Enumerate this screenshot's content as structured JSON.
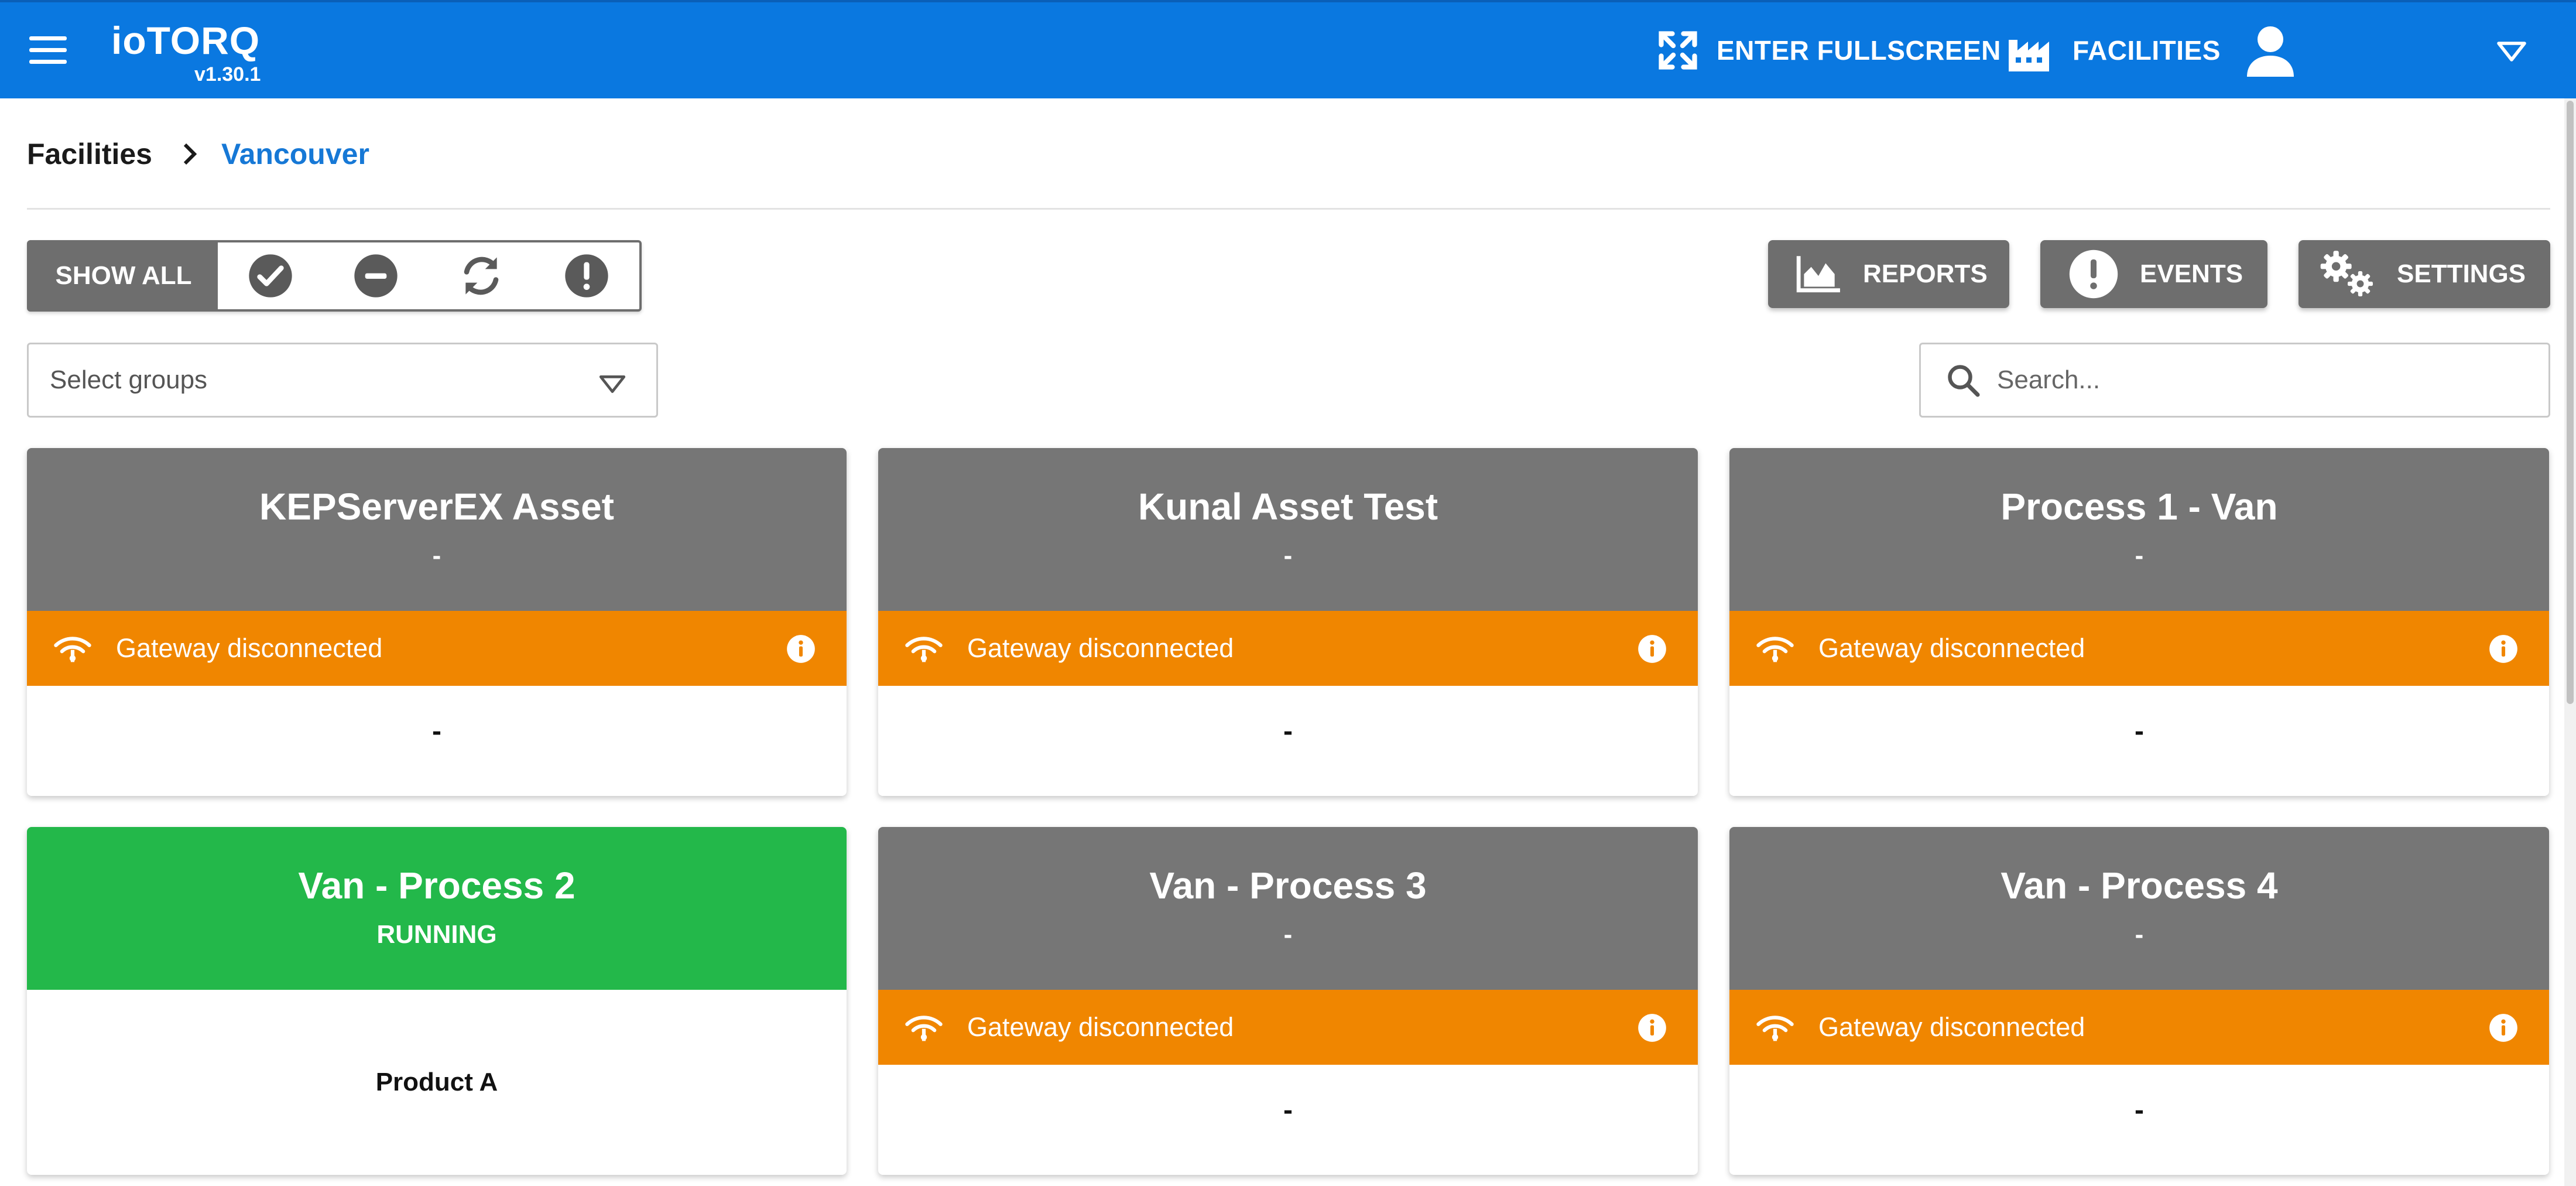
{
  "app": {
    "logo_text": "ioTORQ",
    "version": "v1.30.1",
    "fullscreen_label": "ENTER FULLSCREEN",
    "facilities_label": "FACILITIES",
    "brand_color": "#0a78e0"
  },
  "breadcrumb": {
    "root": "Facilities",
    "current": "Vancouver"
  },
  "filters": {
    "show_all_label": "SHOW ALL",
    "icons": [
      "check-circle-icon",
      "minus-circle-icon",
      "refresh-icon",
      "exclamation-circle-icon"
    ]
  },
  "actions": {
    "reports_label": "REPORTS",
    "events_label": "EVENTS",
    "settings_label": "SETTINGS"
  },
  "select_groups": {
    "placeholder": "Select groups"
  },
  "search": {
    "placeholder": "Search...",
    "value": ""
  },
  "cards": [
    {
      "title": "KEPServerEX Asset",
      "status": "-",
      "alert": "Gateway disconnected",
      "value": "-",
      "state": "disconnected"
    },
    {
      "title": "Kunal Asset Test",
      "status": "-",
      "alert": "Gateway disconnected",
      "value": "-",
      "state": "disconnected"
    },
    {
      "title": "Process 1 - Van",
      "status": "-",
      "alert": "Gateway disconnected",
      "value": "-",
      "state": "disconnected"
    },
    {
      "title": "Van - Process 2",
      "status": "RUNNING",
      "product": "Product A",
      "state": "running"
    },
    {
      "title": "Van - Process 3",
      "status": "-",
      "alert": "Gateway disconnected",
      "value": "-",
      "state": "disconnected"
    },
    {
      "title": "Van - Process 4",
      "status": "-",
      "alert": "Gateway disconnected",
      "value": "-",
      "state": "disconnected"
    }
  ],
  "colors": {
    "disconnected_header": "#767676",
    "running_header": "#23b84a",
    "alert_bar": "#f08600",
    "button_gray": "#6e6e6e"
  }
}
